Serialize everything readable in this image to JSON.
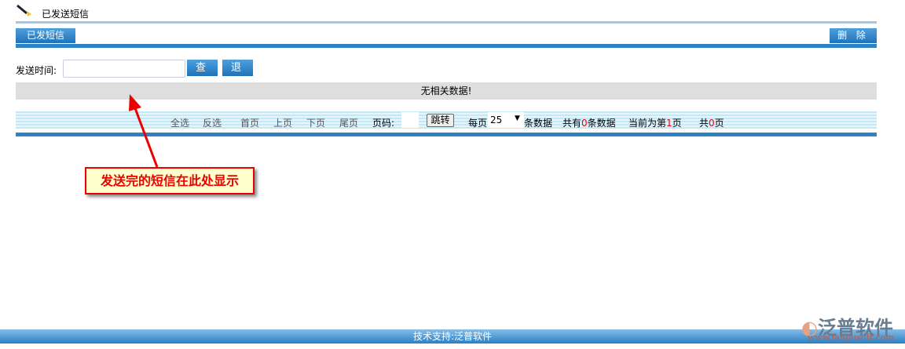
{
  "header": {
    "title": "已发送短信",
    "icon": "pen-icon"
  },
  "tabs": [
    {
      "label": "已发短信"
    }
  ],
  "toolbar": {
    "delete_label": "删 除"
  },
  "search": {
    "label": "发送时间:",
    "value": "",
    "query_label": "查 询",
    "exit_label": "退 出"
  },
  "results": {
    "empty_text": "无相关数据!"
  },
  "pager": {
    "select_all": "全选",
    "invert": "反选",
    "first": "首页",
    "prev": "上页",
    "next": "下页",
    "last": "尾页",
    "page_label": "页码:",
    "page_value": "",
    "jump": "跳转",
    "per_page_label": "每页",
    "per_page": "25",
    "records_suffix": "条数据",
    "total_prefix": "共有",
    "total": "0",
    "total_suffix": "条数据",
    "current_prefix": "当前为第",
    "current": "1",
    "current_suffix": "页",
    "pages_prefix": "共",
    "pages": "0",
    "pages_suffix": "页"
  },
  "annotation": {
    "text": "发送完的短信在此处显示",
    "color": "#ee0000"
  },
  "footer": {
    "text": "技术支持:泛普软件"
  },
  "logo": {
    "name": "泛普软件",
    "url": "www.fanpusoft.com"
  }
}
